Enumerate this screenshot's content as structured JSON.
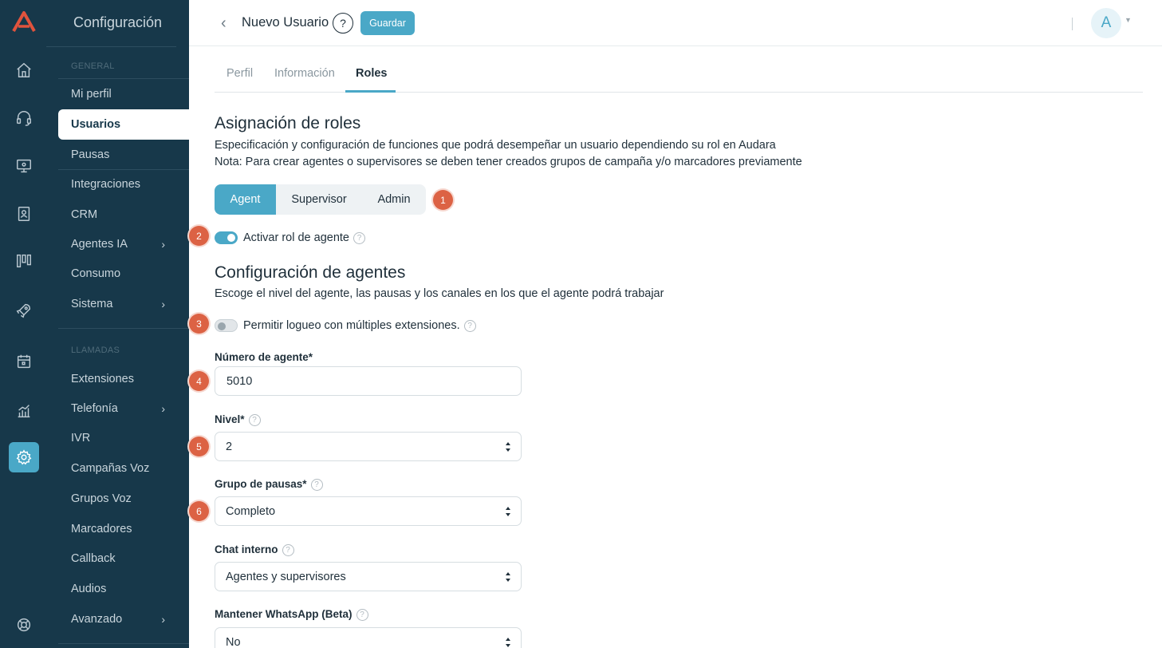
{
  "sidebar": {
    "title": "Configuración",
    "section_general": "GENERAL",
    "section_llamadas": "LLAMADAS",
    "items_general": [
      {
        "label": "Mi perfil"
      },
      {
        "label": "Usuarios"
      },
      {
        "label": "Pausas"
      },
      {
        "label": "Integraciones"
      },
      {
        "label": "CRM"
      },
      {
        "label": "Agentes IA"
      },
      {
        "label": "Consumo"
      },
      {
        "label": "Sistema"
      }
    ],
    "items_llamadas": [
      {
        "label": "Extensiones"
      },
      {
        "label": "Telefonía"
      },
      {
        "label": "IVR"
      },
      {
        "label": "Campañas Voz"
      },
      {
        "label": "Grupos Voz"
      },
      {
        "label": "Marcadores"
      },
      {
        "label": "Callback"
      },
      {
        "label": "Audios"
      },
      {
        "label": "Avanzado"
      }
    ],
    "rail_icons": [
      "home-icon",
      "headset-icon",
      "monitor-icon",
      "contacts-book-icon",
      "kanban-icon",
      "rocket-icon",
      "calendar-icon",
      "analytics-icon",
      "settings-icon",
      "support-icon"
    ]
  },
  "header": {
    "title": "Nuevo Usuario",
    "help": "?",
    "save_label": "Guardar",
    "avatar_initial": "A"
  },
  "tabs": [
    "Perfil",
    "Información",
    "Roles"
  ],
  "roles_section": {
    "title": "Asignación de roles",
    "desc1": "Especificación y configuración de funciones que podrá desempeñar un usuario dependiendo su rol en Audara",
    "desc2": "Nota: Para crear agentes o supervisores se deben tener creados grupos de campaña y/o marcadores previamente",
    "roles": [
      "Agent",
      "Supervisor",
      "Admin"
    ],
    "selected_role": "Agent",
    "activate_label": "Activar rol de agente",
    "activate_on": true
  },
  "agents_section": {
    "title": "Configuración de agentes",
    "desc": "Escoge el nivel del agente, las pausas y los canales en los que el agente podrá trabajar",
    "multi_login_label": "Permitir logueo con múltiples extensiones.",
    "multi_login_on": false,
    "agent_number_label": "Número de agente*",
    "agent_number_value": "5010",
    "level_label": "Nivel*",
    "level_value": "2",
    "pause_group_label": "Grupo de pausas*",
    "pause_group_value": "Completo",
    "internal_chat_label": "Chat interno",
    "internal_chat_value": "Agentes y supervisores",
    "whatsapp_label": "Mantener WhatsApp (Beta)",
    "whatsapp_value": "No"
  },
  "badges": [
    "1",
    "2",
    "3",
    "4",
    "5",
    "6"
  ],
  "colors": {
    "sidebar_bg": "#17384a",
    "accent": "#4aa8c7",
    "badge": "#dc6244",
    "text": "#1f2f3a"
  }
}
